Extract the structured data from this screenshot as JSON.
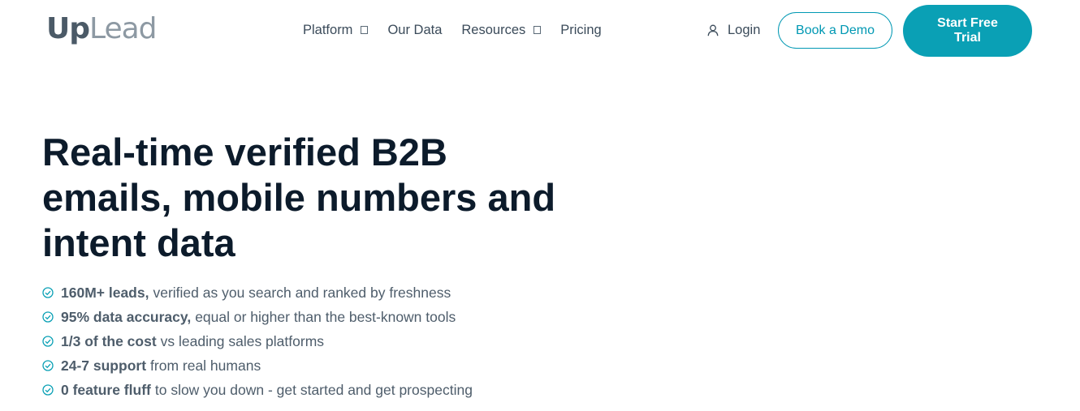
{
  "logo": {
    "part1": "Up",
    "part2": "Lead"
  },
  "nav": [
    {
      "label": "Platform",
      "has_dropdown": true
    },
    {
      "label": "Our Data",
      "has_dropdown": false
    },
    {
      "label": "Resources",
      "has_dropdown": true
    },
    {
      "label": "Pricing",
      "has_dropdown": false
    }
  ],
  "header": {
    "login_label": "Login",
    "demo_label": "Book a Demo",
    "trial_label": "Start Free Trial"
  },
  "hero": {
    "headline": "Real-time verified B2B emails, mobile numbers and intent data",
    "features": [
      {
        "bold": "160M+ leads,",
        "text": "verified as you search and ranked by freshness"
      },
      {
        "bold": "95% data accuracy,",
        "text": "equal or higher than the best-known tools"
      },
      {
        "bold": "1/3 of the cost",
        "text": "vs leading sales platforms"
      },
      {
        "bold": "24-7 support",
        "text": "from real humans"
      },
      {
        "bold": "0 feature fluff",
        "text": "to slow you down - get started and get prospecting"
      }
    ]
  },
  "colors": {
    "accent": "#0aa0b5",
    "heading": "#0c1b2b",
    "body_text": "#4e5d6b"
  },
  "icons": {
    "login": "user-icon",
    "feature": "check-circle-icon",
    "dropdown": "chevron-down-icon"
  }
}
